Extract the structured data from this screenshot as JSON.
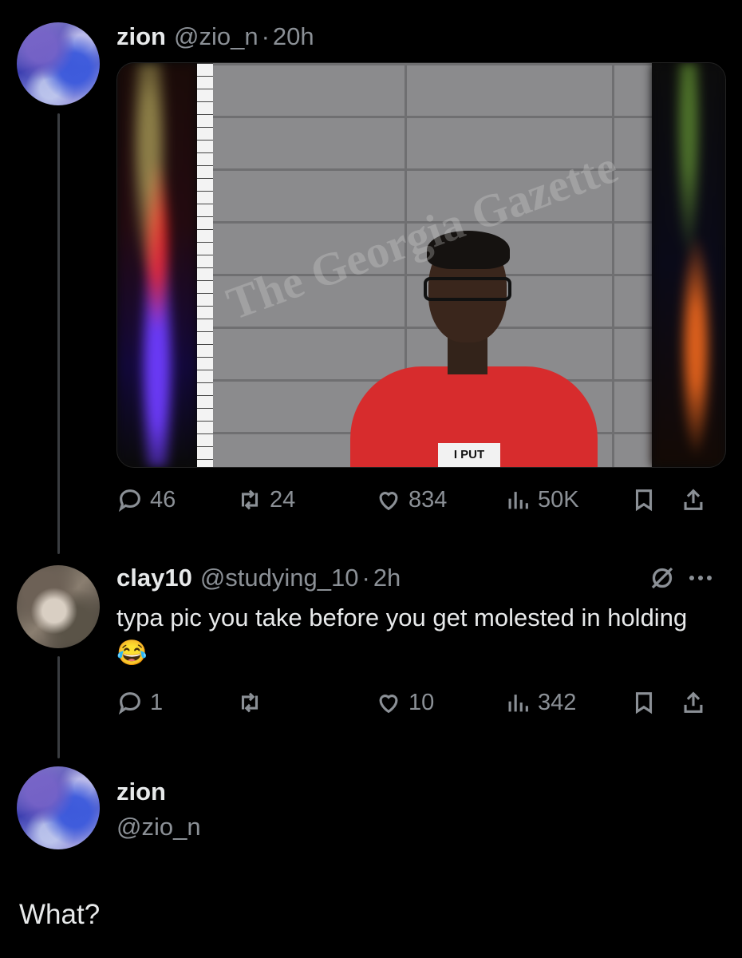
{
  "tweet_main": {
    "display_name": "zion",
    "handle": "@zio_n",
    "separator": "·",
    "timestamp": "20h",
    "media": {
      "watermark_text": "The Georgia Gazette",
      "shirt_tag_text": "I PUT"
    },
    "actions": {
      "replies": "46",
      "retweets": "24",
      "likes": "834",
      "views": "50K"
    }
  },
  "tweet_reply": {
    "display_name": "clay10",
    "handle": "@studying_10",
    "separator": "·",
    "timestamp": "2h",
    "text": "typa pic you take before you get molested in holding",
    "emoji": "😂",
    "actions": {
      "replies": "1",
      "retweets": "",
      "likes": "10",
      "views": "342"
    }
  },
  "tweet_focus": {
    "display_name": "zion",
    "handle": "@zio_n",
    "text": "What?"
  },
  "icons": {
    "reply": "reply-icon",
    "retweet": "retweet-icon",
    "like": "heart-icon",
    "views": "views-icon",
    "bookmark": "bookmark-icon",
    "share": "share-icon",
    "grok": "grok-icon",
    "more": "more-icon"
  },
  "colors": {
    "background": "#000000",
    "text_primary": "#e7e9ea",
    "text_secondary": "#8b9096",
    "thread_line": "#3a3d41"
  }
}
